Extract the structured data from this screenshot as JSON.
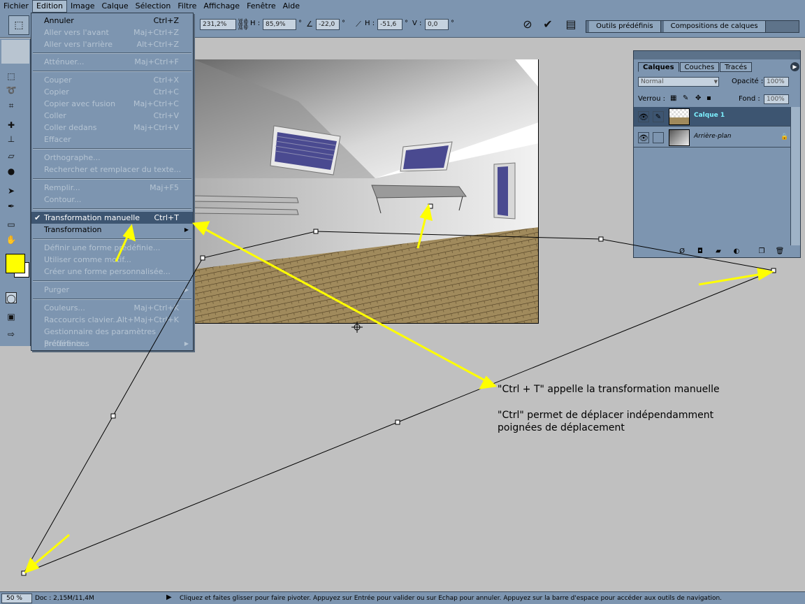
{
  "menubar": {
    "items": [
      "Fichier",
      "Edition",
      "Image",
      "Calque",
      "Sélection",
      "Filtre",
      "Affichage",
      "Fenêtre",
      "Aide"
    ],
    "active": "Edition"
  },
  "options_bar": {
    "w_value": "231,2%",
    "h_label": "H :",
    "h_value": "85,9%",
    "angle_value": "-22,0",
    "skew_h_label": "H :",
    "skew_h_value": "-51,6",
    "skew_v_label": "V :",
    "skew_v_value": "0,0",
    "degree": "°",
    "wells": [
      "Outils prédéfinis",
      "Compositions de calques"
    ]
  },
  "edit_menu": {
    "items": [
      {
        "label": "Annuler",
        "shortcut": "Ctrl+Z",
        "state": "enabled"
      },
      {
        "label": "Aller vers l'avant",
        "shortcut": "Maj+Ctrl+Z",
        "state": "disabled"
      },
      {
        "label": "Aller vers l'arrière",
        "shortcut": "Alt+Ctrl+Z",
        "state": "disabled"
      },
      {
        "label": "Atténuer...",
        "shortcut": "Maj+Ctrl+F",
        "state": "disabled"
      },
      {
        "label": "Couper",
        "shortcut": "Ctrl+X",
        "state": "disabled"
      },
      {
        "label": "Copier",
        "shortcut": "Ctrl+C",
        "state": "disabled"
      },
      {
        "label": "Copier avec fusion",
        "shortcut": "Maj+Ctrl+C",
        "state": "disabled"
      },
      {
        "label": "Coller",
        "shortcut": "Ctrl+V",
        "state": "disabled"
      },
      {
        "label": "Coller dedans",
        "shortcut": "Maj+Ctrl+V",
        "state": "disabled"
      },
      {
        "label": "Effacer",
        "shortcut": "",
        "state": "disabled"
      },
      {
        "label": "Orthographe...",
        "shortcut": "",
        "state": "disabled"
      },
      {
        "label": "Rechercher et remplacer du texte...",
        "shortcut": "",
        "state": "disabled"
      },
      {
        "label": "Remplir...",
        "shortcut": "Maj+F5",
        "state": "disabled"
      },
      {
        "label": "Contour...",
        "shortcut": "",
        "state": "disabled"
      },
      {
        "label": "Transformation manuelle",
        "shortcut": "Ctrl+T",
        "state": "highlighted"
      },
      {
        "label": "Transformation",
        "shortcut": "",
        "state": "enabled"
      },
      {
        "label": "Définir une forme prédéfinie...",
        "shortcut": "",
        "state": "disabled"
      },
      {
        "label": "Utiliser comme motif...",
        "shortcut": "",
        "state": "disabled"
      },
      {
        "label": "Créer une forme personnalisée...",
        "shortcut": "",
        "state": "disabled"
      },
      {
        "label": "Purger",
        "shortcut": "",
        "state": "disabled"
      },
      {
        "label": "Couleurs...",
        "shortcut": "Maj+Ctrl+K",
        "state": "disabled"
      },
      {
        "label": "Raccourcis clavier...",
        "shortcut": "Alt+Maj+Ctrl+K",
        "state": "disabled"
      },
      {
        "label": "Gestionnaire des paramètres prédéfinis...",
        "shortcut": "",
        "state": "disabled"
      },
      {
        "label": "Préférences",
        "shortcut": "",
        "state": "disabled"
      }
    ]
  },
  "layers_panel": {
    "tabs": [
      "Calques",
      "Couches",
      "Tracés"
    ],
    "active_tab": "Calques",
    "blend_mode": "Normal",
    "opacity_label": "Opacité :",
    "opacity_value": "100%",
    "lock_label": "Verrou :",
    "fill_label": "Fond :",
    "fill_value": "100%",
    "layers": [
      {
        "name": "Calque 1",
        "selected": true
      },
      {
        "name": "Arrière-plan",
        "selected": false
      }
    ]
  },
  "annotations": {
    "line1": "\"Ctrl + T\" appelle la transformation manuelle",
    "line2": "\"Ctrl\" permet de déplacer indépendamment",
    "line3": "poignées de déplacement"
  },
  "status_bar": {
    "zoom": "50 %",
    "doc": "Doc : 2,15M/11,4M",
    "hint": "Cliquez et faites glisser pour faire pivoter. Appuyez sur Entrée pour valider ou sur Echap pour annuler. Appuyez sur la barre d'espace pour accéder aux outils de navigation."
  },
  "colors": {
    "foreground": "#ffff00",
    "background": "#ffffff",
    "ui": "#7d95b0",
    "highlight": "#3d5571",
    "arrow": "#ffff00"
  }
}
